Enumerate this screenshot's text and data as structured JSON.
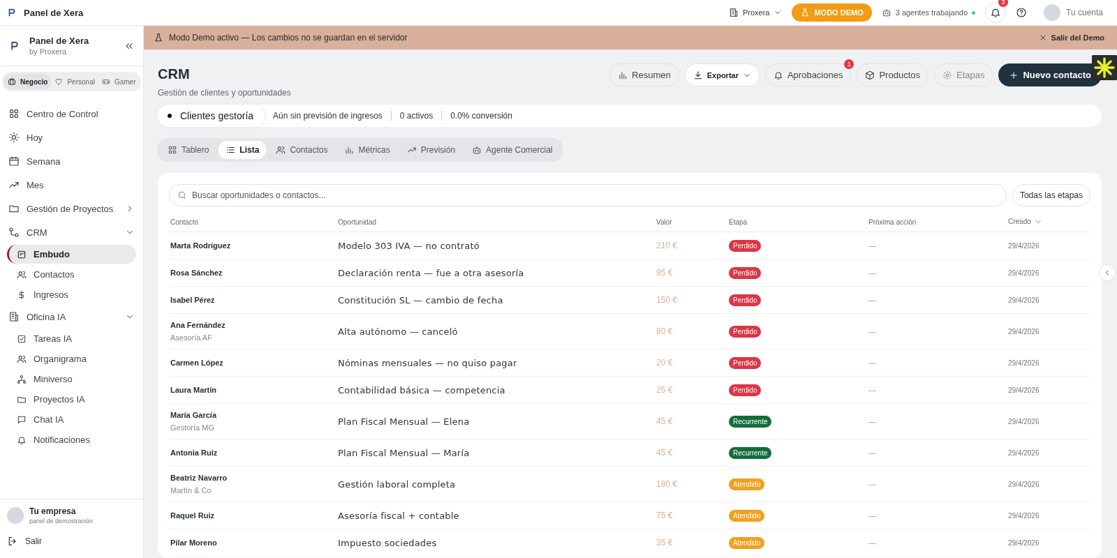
{
  "topbar": {
    "app_title": "Panel de Xera",
    "org": "Proxera",
    "demo_button": "MODO DEMO",
    "agents": "3 agentes trabajando",
    "notifications_count": "3",
    "account": "Tu cuenta"
  },
  "banner": {
    "text": "Modo Demo activo — Los cambios no se guardan en el servidor",
    "exit": "Salir del Demo"
  },
  "sidebar": {
    "brand": "Panel de Xera",
    "brand_sub": "by Proxera",
    "modes": [
      {
        "label": "Negocio",
        "selected": true
      },
      {
        "label": "Personal",
        "selected": false
      },
      {
        "label": "Gamer",
        "selected": false
      }
    ],
    "items": [
      {
        "label": "Centro de Control"
      },
      {
        "label": "Hoy"
      },
      {
        "label": "Semana"
      },
      {
        "label": "Mes"
      },
      {
        "label": "Gestión de Proyectos",
        "expanded": false
      },
      {
        "label": "CRM",
        "expanded": true,
        "children": [
          {
            "label": "Embudo",
            "selected": true
          },
          {
            "label": "Contactos",
            "selected": false
          },
          {
            "label": "Ingresos",
            "selected": false
          }
        ]
      },
      {
        "label": "Oficina IA",
        "expanded": true,
        "children": [
          {
            "label": "Tareas IA",
            "selected": false
          },
          {
            "label": "Organigrama",
            "selected": false
          },
          {
            "label": "Miniverso",
            "selected": false
          },
          {
            "label": "Proyectos IA",
            "selected": false
          },
          {
            "label": "Chat IA",
            "selected": false
          },
          {
            "label": "Notificaciones",
            "selected": false
          }
        ]
      }
    ],
    "company": "Tu empresa",
    "company_sub": "panel de demostración",
    "logout": "Salir"
  },
  "header": {
    "title": "CRM",
    "subtitle": "Gestión de clientes y oportunidades",
    "actions": [
      {
        "label": "Resumen",
        "kind": "ghost"
      },
      {
        "label": "Exportar",
        "kind": "dropdown"
      },
      {
        "label": "Aprobaciones",
        "kind": "ghost",
        "badge": "1"
      },
      {
        "label": "Productos",
        "kind": "ghost"
      },
      {
        "label": "Etapas",
        "kind": "muted"
      },
      {
        "label": "Nuevo contacto",
        "kind": "primary"
      }
    ]
  },
  "pipeline": {
    "name": "Clientes gestoría",
    "forecast": "Aún sin previsión de ingresos",
    "active": "0 activos",
    "conversion": "0.0% conversión"
  },
  "tabs": [
    {
      "label": "Tablero",
      "selected": false
    },
    {
      "label": "Lista",
      "selected": true
    },
    {
      "label": "Contactos",
      "selected": false
    },
    {
      "label": "Métricas",
      "selected": false
    },
    {
      "label": "Previsión",
      "selected": false
    },
    {
      "label": "Agente Comercial",
      "selected": false
    }
  ],
  "search": {
    "placeholder": "Buscar oportunidades o contactos..."
  },
  "stage_filter": "Todas las etapas",
  "table": {
    "columns": [
      "Contacto",
      "Oportunidad",
      "Valor",
      "Etapa",
      "Próxima acción",
      "Creado"
    ],
    "rows": [
      {
        "contact": "Marta Rodríguez",
        "opportunity": "Modelo 303 IVA — no contrató",
        "value": "210 €",
        "stage": "Perdido",
        "color": "#dc3545",
        "next": "—",
        "created": "29/4/2026"
      },
      {
        "contact": "Rosa Sánchez",
        "opportunity": "Declaración renta — fue a otra asesoría",
        "value": "95 €",
        "stage": "Perdido",
        "color": "#dc3545",
        "next": "—",
        "created": "29/4/2026"
      },
      {
        "contact": "Isabel Pérez",
        "opportunity": "Constitución SL — cambio de fecha",
        "value": "150 €",
        "stage": "Perdido",
        "color": "#dc3545",
        "next": "—",
        "created": "29/4/2026"
      },
      {
        "contact": "Ana Fernández",
        "company": "Asesoría AF",
        "opportunity": "Alta autónomo — canceló",
        "value": "80 €",
        "stage": "Perdido",
        "color": "#dc3545",
        "next": "—",
        "created": "29/4/2026"
      },
      {
        "contact": "Carmen López",
        "opportunity": "Nóminas mensuales — no quiso pagar",
        "value": "20 €",
        "stage": "Perdido",
        "color": "#dc3545",
        "next": "—",
        "created": "29/4/2026"
      },
      {
        "contact": "Laura Martín",
        "opportunity": "Contabilidad básica — competencia",
        "value": "25 €",
        "stage": "Perdido",
        "color": "#dc3545",
        "next": "—",
        "created": "29/4/2026"
      },
      {
        "contact": "María García",
        "company": "Gestoría MG",
        "opportunity": "Plan Fiscal Mensual — Elena",
        "value": "45 €",
        "stage": "Recurrente",
        "color": "#146c3a",
        "next": "—",
        "created": "29/4/2026"
      },
      {
        "contact": "Antonia Ruiz",
        "opportunity": "Plan Fiscal Mensual — María",
        "value": "45 €",
        "stage": "Recurrente",
        "color": "#146c3a",
        "next": "—",
        "created": "29/4/2026"
      },
      {
        "contact": "Beatriz Navarro",
        "company": "Martín & Co",
        "opportunity": "Gestión laboral completa",
        "value": "180 €",
        "stage": "Atendido",
        "color": "#f0a01e",
        "next": "—",
        "created": "29/4/2026"
      },
      {
        "contact": "Raquel Ruiz",
        "opportunity": "Asesoría fiscal + contable",
        "value": "75 €",
        "stage": "Atendido",
        "color": "#f0a01e",
        "next": "—",
        "created": "29/4/2026"
      },
      {
        "contact": "Pilar Moreno",
        "opportunity": "Impuesto sociedades",
        "value": "35 €",
        "stage": "Atendido",
        "color": "#f0a01e",
        "next": "—",
        "created": "29/4/2026"
      }
    ]
  }
}
